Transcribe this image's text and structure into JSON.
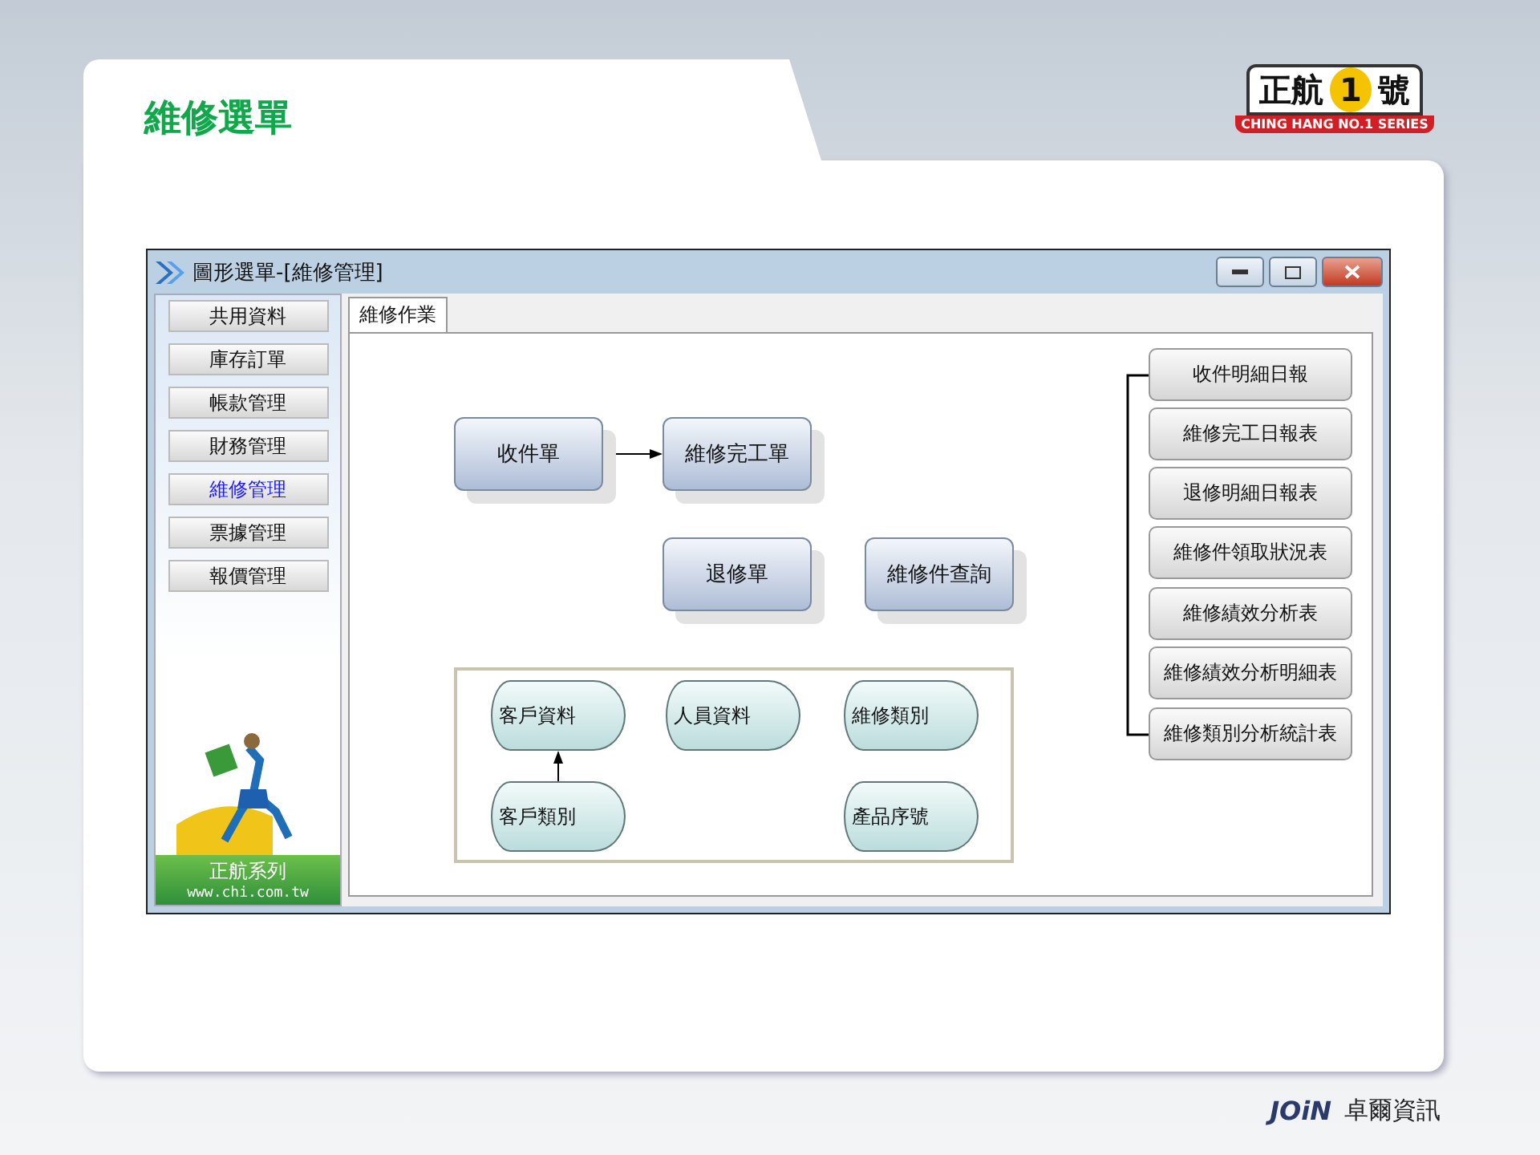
{
  "slide": {
    "title": "維修選單"
  },
  "logo": {
    "parts": [
      "正航",
      "1",
      "號"
    ],
    "subtitle": "CHING HANG NO.1 SERIES"
  },
  "window": {
    "title": "圖形選單-[維修管理]"
  },
  "sidebar": {
    "items": [
      {
        "label": "共用資料",
        "selected": false
      },
      {
        "label": "庫存訂單",
        "selected": false
      },
      {
        "label": "帳款管理",
        "selected": false
      },
      {
        "label": "財務管理",
        "selected": false
      },
      {
        "label": "維修管理",
        "selected": true
      },
      {
        "label": "票據管理",
        "selected": false
      },
      {
        "label": "報價管理",
        "selected": false
      }
    ],
    "brand": "正航系列",
    "url": "www.chi.com.tw"
  },
  "tabs": [
    {
      "label": "維修作業",
      "selected": true
    }
  ],
  "flow": {
    "nodes": [
      {
        "label": "收件單"
      },
      {
        "label": "維修完工單"
      },
      {
        "label": "退修單"
      },
      {
        "label": "維修件查詢"
      }
    ]
  },
  "data_tables": [
    {
      "label": "客戶資料"
    },
    {
      "label": "人員資料"
    },
    {
      "label": "維修類別"
    },
    {
      "label": "客戶類別"
    },
    {
      "label": "產品序號"
    }
  ],
  "reports": [
    "收件明細日報",
    "維修完工日報表",
    "退修明細日報表",
    "維修件領取狀況表",
    "維修績效分析表",
    "維修績效分析明細表",
    "維修類別分析統計表"
  ],
  "footer": {
    "logo": "JOiN",
    "company": "卓爾資訊"
  }
}
